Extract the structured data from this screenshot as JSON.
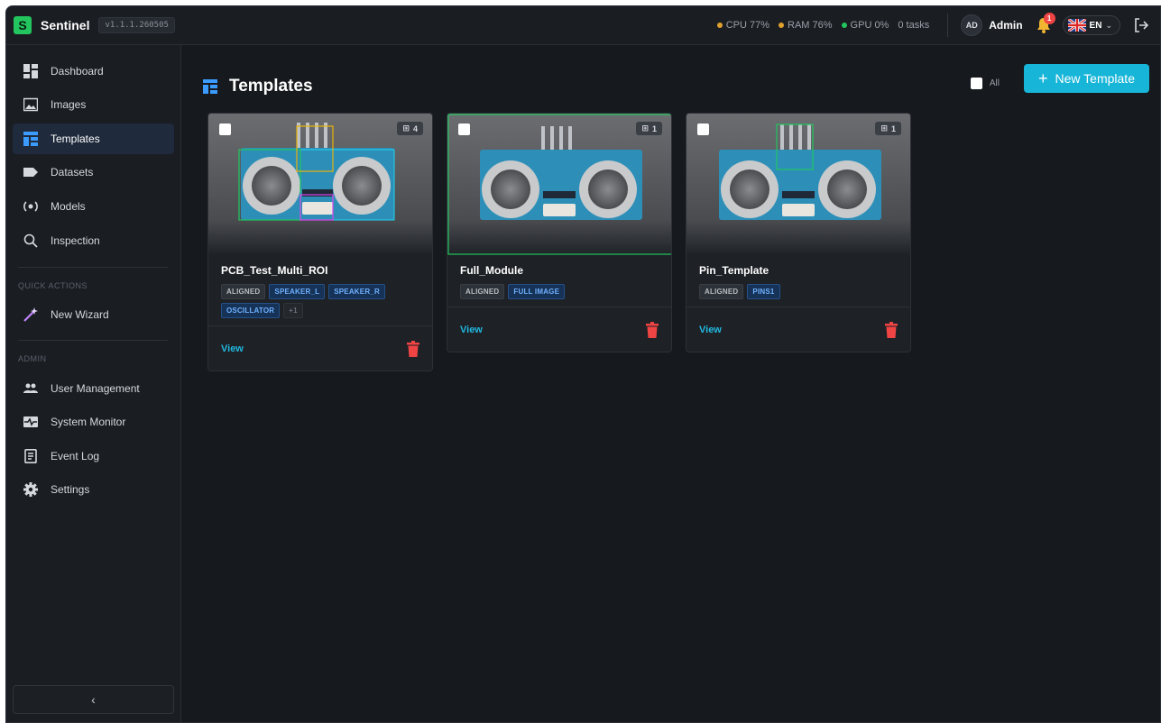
{
  "app": {
    "logo_letter": "S",
    "name": "Sentinel",
    "version": "v1.1.1.260505"
  },
  "topbar": {
    "stats": [
      {
        "label": "CPU 77%",
        "color": "#e0a12e"
      },
      {
        "label": "RAM 76%",
        "color": "#e0a12e"
      },
      {
        "label": "GPU 0%",
        "color": "#22c55e"
      }
    ],
    "tasks": "0 tasks",
    "user_initials": "AD",
    "user_name": "Admin",
    "notification_count": "1",
    "language": "EN"
  },
  "sidebar": {
    "items": [
      {
        "label": "Dashboard",
        "icon": "dashboard-icon"
      },
      {
        "label": "Images",
        "icon": "image-icon"
      },
      {
        "label": "Templates",
        "icon": "templates-icon",
        "active": true
      },
      {
        "label": "Datasets",
        "icon": "tag-icon"
      },
      {
        "label": "Models",
        "icon": "model-icon"
      },
      {
        "label": "Inspection",
        "icon": "search-icon"
      }
    ],
    "quick_actions_label": "QUICK ACTIONS",
    "quick_actions": [
      {
        "label": "New Wizard",
        "icon": "magic-wand-icon"
      }
    ],
    "admin_label": "ADMIN",
    "admin_items": [
      {
        "label": "User Management",
        "icon": "users-icon"
      },
      {
        "label": "System Monitor",
        "icon": "monitor-icon"
      },
      {
        "label": "Event Log",
        "icon": "log-icon"
      },
      {
        "label": "Settings",
        "icon": "gear-icon"
      }
    ],
    "collapse_label": "‹"
  },
  "main": {
    "title": "Templates",
    "select_all_label": "All",
    "new_button_label": "New Template",
    "cards": [
      {
        "title": "PCB_Test_Multi_ROI",
        "roi_count": "4",
        "tags": [
          {
            "text": "ALIGNED",
            "style": "neutral"
          },
          {
            "text": "SPEAKER_L",
            "style": "blue"
          },
          {
            "text": "SPEAKER_R",
            "style": "blue"
          },
          {
            "text": "OSCILLATOR",
            "style": "blue"
          },
          {
            "text": "+1",
            "style": "more"
          }
        ],
        "view_label": "View"
      },
      {
        "title": "Full_Module",
        "roi_count": "1",
        "tags": [
          {
            "text": "ALIGNED",
            "style": "neutral"
          },
          {
            "text": "FULL IMAGE",
            "style": "blue"
          }
        ],
        "view_label": "View"
      },
      {
        "title": "Pin_Template",
        "roi_count": "1",
        "tags": [
          {
            "text": "ALIGNED",
            "style": "neutral"
          },
          {
            "text": "PINS1",
            "style": "blue"
          }
        ],
        "view_label": "View"
      }
    ]
  },
  "colors": {
    "accent": "#17b5d8",
    "danger": "#ef4444",
    "active_nav": "#1f2a3c",
    "tag_blue": "#6fb1ff"
  }
}
